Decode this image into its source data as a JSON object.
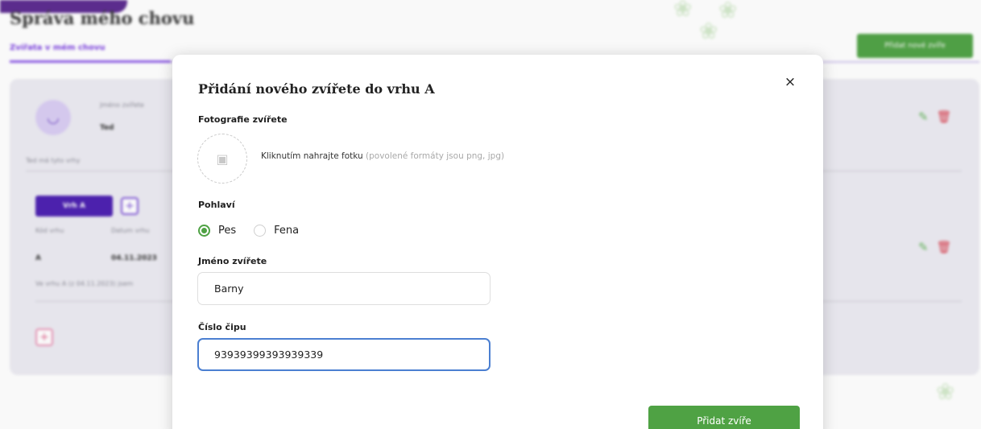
{
  "background": {
    "page_title": "Správa mého chovu",
    "subtab": "Zvířata v mém chovu",
    "add_animal_top_button": "Přidat nové zvíře",
    "card": {
      "animal_name_label": "Jméno zvířete",
      "animal_name_value": "Ted",
      "animal_note": "Ted má tyto vrhy",
      "litter_button": "Vrh A",
      "litter_code_label": "Kód vrhu",
      "litter_code_value": "A",
      "litter_date_label": "Datum vrhu",
      "litter_date_value": "04.11.2023",
      "litter_note": "Ve vrhu A (z 04.11.2023) jsem"
    },
    "icons": {
      "avatar": "tooth-icon",
      "edit": "pencil-icon",
      "delete": "trash-icon",
      "decor": "paw-icon"
    },
    "colors": {
      "brand_purple": "#4b1fb0",
      "accent_green": "#4fa244",
      "danger_red": "#d83b4a"
    }
  },
  "modal": {
    "title": "Přidání nového zvířete do vrhu A",
    "close_icon": "×",
    "photo_label": "Fotografie zvířete",
    "upload_text": "Kliknutím nahrajte fotku",
    "upload_hint": "(povolené formáty jsou png, jpg)",
    "gender_label": "Pohlaví",
    "gender_options": [
      {
        "label": "Pes",
        "checked": true
      },
      {
        "label": "Fena",
        "checked": false
      }
    ],
    "name_label": "Jméno zvířete",
    "name_value": "Barny",
    "chip_label": "Číslo čipu",
    "chip_value": "93939399393939339",
    "submit_label": "Přidat zvíře"
  }
}
